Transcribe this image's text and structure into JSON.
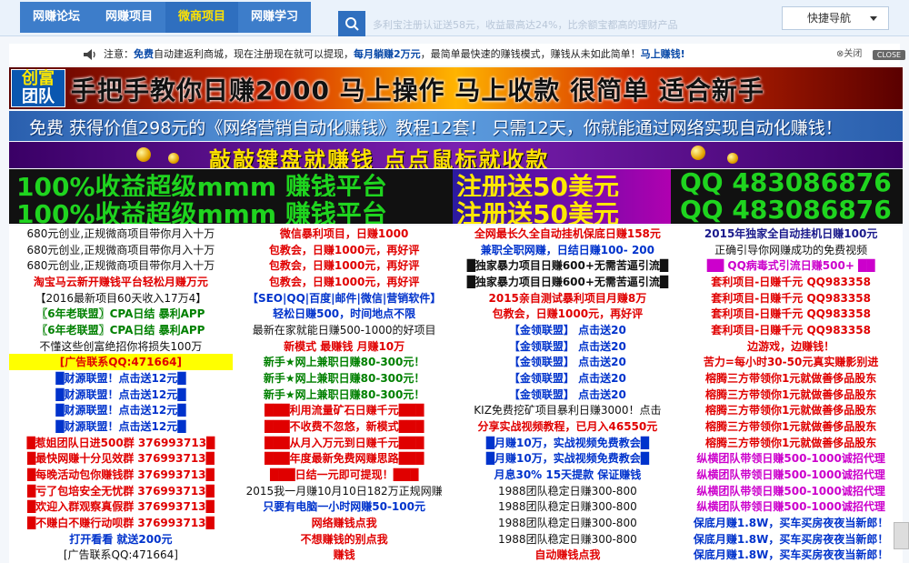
{
  "nav": {
    "items": [
      {
        "label": "网赚论坛",
        "active": false
      },
      {
        "label": "网赚项目",
        "active": false
      },
      {
        "label": "微商项目",
        "active": true
      },
      {
        "label": "网赚学习",
        "active": false
      }
    ],
    "marquee": "多利宝注册认证送58元，收益最高达24%，比余额宝都高的理财产品",
    "quick_nav": "快捷导航"
  },
  "notice": {
    "prefix": "注意：",
    "free": "免费",
    "text1": "自动建返利商城，现在注册现在就可以提现，",
    "highlight1": "每月躺赚2万元",
    "text2": "，最简单最快速的赚钱模式，赚钱从未如此简单！",
    "link": "马上赚钱!",
    "close_label": "关闭",
    "close_badge": "CLOSE"
  },
  "banners": {
    "b1_logo_top": "创富",
    "b1_logo_bottom": "团队",
    "b1_text": "手把手教你日赚2000 马上操作 马上收款 很简单 适合新手",
    "b2_text": "免费  获得价值298元的《网络营销自动化赚钱》教程12套！  只需12天，你就能通过网络实现自动化赚钱！",
    "b3_text": "敲敲键盘就赚钱 点点鼠标就收款",
    "b4_left": "100%收益超级mmm 赚钱平台",
    "b4_mid": "注册送50美元",
    "b4_right": "QQ 483086876",
    "b5_left": "100%收益超级mmm 赚钱平台",
    "b5_mid": "注册送50美元",
    "b5_right": "QQ 483086876"
  },
  "grid": {
    "col1": [
      {
        "text": "680元创业,正规微商项目带你月入十万",
        "color": "black"
      },
      {
        "text": "680元创业,正规微商项目带你月入十万",
        "color": "black"
      },
      {
        "text": "680元创业,正规微商项目带你月入十万",
        "color": "black"
      },
      {
        "text": "淘宝马云新开赚钱平台轻松月赚万元",
        "color": "red"
      },
      {
        "text": "【2016最新项目60天收入17万4】",
        "color": "black"
      },
      {
        "text": "〖6年老联盟〗CPA日结 暴利APP",
        "color": "green"
      },
      {
        "text": "〖6年老联盟〗CPA日结 暴利APP",
        "color": "green"
      },
      {
        "text": "不懂这些创富绝招你将损失100万",
        "color": "black"
      },
      {
        "text": "[广告联系QQ:471664]",
        "color": "red",
        "hl": true
      },
      {
        "text": "█财源联盟！点击送12元█",
        "color": "blue"
      },
      {
        "text": "█财源联盟！点击送12元█",
        "color": "blue"
      },
      {
        "text": "█财源联盟！点击送12元█",
        "color": "blue"
      },
      {
        "text": "█财源联盟！点击送12元█",
        "color": "blue"
      },
      {
        "text": "█惹姐团队日进500群 376993713█",
        "color": "red"
      },
      {
        "text": "█最快网赚十分见效群 376993713█",
        "color": "red"
      },
      {
        "text": "█每晚活动包你赚钱群 376993713█",
        "color": "red"
      },
      {
        "text": "█亏了包培安全无忧群 376993713█",
        "color": "red"
      },
      {
        "text": "█欢迎入群观察真假群 376993713█",
        "color": "red"
      },
      {
        "text": "█不赚白不赚行动呗群 376993713█",
        "color": "red"
      },
      {
        "text": "打开看看 就送200元",
        "color": "blue"
      },
      {
        "text": "[广告联系QQ:471664]",
        "color": "black"
      }
    ],
    "col2": [
      {
        "text": "微信暴利项目，日赚1000",
        "color": "red"
      },
      {
        "text": "包教会，日赚1000元，再好评",
        "color": "red"
      },
      {
        "text": "包教会，日赚1000元，再好评",
        "color": "red"
      },
      {
        "text": "包教会，日赚1000元，再好评",
        "color": "red"
      },
      {
        "text": "【SEO|QQ|百度|邮件|微信|营销软件】",
        "color": "blue"
      },
      {
        "text": "轻松日赚500，时间地点不限",
        "color": "blue"
      },
      {
        "text": "最新在家就能日赚500-1000的好项目",
        "color": "black"
      },
      {
        "text": "新模式 最赚钱 月赚10万",
        "color": "red"
      },
      {
        "text": "新手★网上兼职日赚80-300元！",
        "color": "green"
      },
      {
        "text": "新手★网上兼职日赚80-300元！",
        "color": "green"
      },
      {
        "text": "新手★网上兼职日赚80-300元！",
        "color": "green"
      },
      {
        "text": "███利用流量矿石日赚千元███",
        "color": "red"
      },
      {
        "text": "███不收费不忽悠，新模式███",
        "color": "red"
      },
      {
        "text": "███从月入万元到日赚千元███",
        "color": "red"
      },
      {
        "text": "███年度最新免费网赚思路███",
        "color": "red"
      },
      {
        "text": "███日结一元即可提现！███",
        "color": "red"
      },
      {
        "text": "2015我一月赚10月10日182万正规网赚",
        "color": "black"
      },
      {
        "text": "只要有电脑一小时网赚50-100元",
        "color": "blue"
      },
      {
        "text": "网络赚钱点我",
        "color": "red"
      },
      {
        "text": "不想赚钱的别点我",
        "color": "red"
      },
      {
        "text": "赚钱",
        "color": "red"
      }
    ],
    "col3": [
      {
        "text": "全网最长久全自动挂机保底日赚158元",
        "color": "red"
      },
      {
        "text": "兼职全职网赚，日结日赚100- 200",
        "color": "blue"
      },
      {
        "text": "█独家暴力项目日赚600+无需苦逼引流█",
        "color": "black"
      },
      {
        "text": "█独家暴力项目日赚600+无需苦逼引流█",
        "color": "black"
      },
      {
        "text": "2015亲自测试暴利项目月赚8万",
        "color": "red"
      },
      {
        "text": "包教会，日赚1000元，再好评",
        "color": "red"
      },
      {
        "text": "【金领联盟】 点击送20",
        "color": "blue"
      },
      {
        "text": "【金领联盟】 点击送20",
        "color": "blue"
      },
      {
        "text": "【金领联盟】 点击送20",
        "color": "blue"
      },
      {
        "text": "【金领联盟】 点击送20",
        "color": "blue"
      },
      {
        "text": "【金领联盟】 点击送20",
        "color": "blue"
      },
      {
        "text": "KIZ免费挖矿项目暴利日赚3000！点击",
        "color": "black"
      },
      {
        "text": "分享实战视频教程，已月入46550元",
        "color": "red"
      },
      {
        "text": "█月赚10万，实战视频免费教会█",
        "color": "blue"
      },
      {
        "text": "█月赚10万，实战视频免费教会█",
        "color": "blue"
      },
      {
        "text": "月息30% 15天提款 保证赚钱",
        "color": "blue"
      },
      {
        "text": "1988团队稳定日赚300-800",
        "color": "black"
      },
      {
        "text": "1988团队稳定日赚300-800",
        "color": "black"
      },
      {
        "text": "1988团队稳定日赚300-800",
        "color": "black"
      },
      {
        "text": "1988团队稳定日赚300-800",
        "color": "black"
      },
      {
        "text": "自动赚钱点我",
        "color": "red"
      }
    ],
    "col4": [
      {
        "text": "2015年独家全自动挂机日赚100元",
        "color": "navy"
      },
      {
        "text": "正确引导你网赚成功的免费视频",
        "color": "black"
      },
      {
        "text": "██ QQ病毒式引流日赚500+ ██",
        "color": "magenta"
      },
      {
        "text": "套利项目-日赚千元 QQ983358",
        "color": "red"
      },
      {
        "text": "套利项目-日赚千元 QQ983358",
        "color": "red"
      },
      {
        "text": "套利项目-日赚千元 QQ983358",
        "color": "red"
      },
      {
        "text": "套利项目-日赚千元 QQ983358",
        "color": "red"
      },
      {
        "text": "边游戏，边赚钱！",
        "color": "red"
      },
      {
        "text": "苦力=每小时30-50元真实赚影别进",
        "color": "red"
      },
      {
        "text": "榕腾三方带领你1元就做善侈品股东",
        "color": "red"
      },
      {
        "text": "榕腾三方带领你1元就做善侈品股东",
        "color": "red"
      },
      {
        "text": "榕腾三方带领你1元就做善侈品股东",
        "color": "red"
      },
      {
        "text": "榕腾三方带领你1元就做善侈品股东",
        "color": "red"
      },
      {
        "text": "榕腾三方带领你1元就做善侈品股东",
        "color": "red"
      },
      {
        "text": "纵横团队带领日赚500-1000诚招代理",
        "color": "magenta"
      },
      {
        "text": "纵横团队带领日赚500-1000诚招代理",
        "color": "magenta"
      },
      {
        "text": "纵横团队带领日赚500-1000诚招代理",
        "color": "magenta"
      },
      {
        "text": "纵横团队带领日赚500-1000诚招代理",
        "color": "magenta"
      },
      {
        "text": "保底月赚1.8W，买车买房夜夜当新郎！",
        "color": "blue"
      },
      {
        "text": "保底月赚1.8W，买车买房夜夜当新郎！",
        "color": "blue"
      },
      {
        "text": "保底月赚1.8W，买车买房夜夜当新郎！",
        "color": "blue"
      }
    ]
  }
}
